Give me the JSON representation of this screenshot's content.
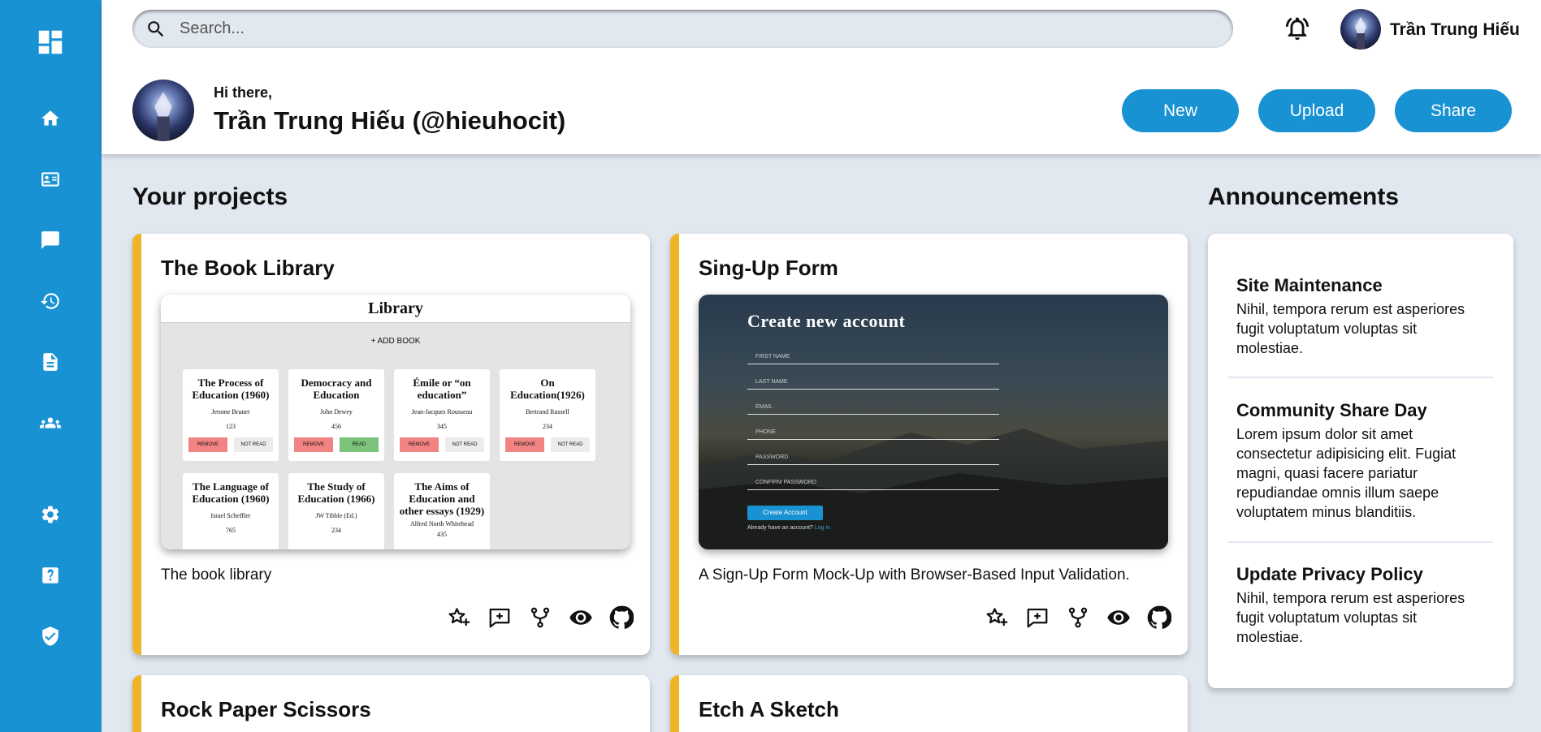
{
  "header": {
    "search_placeholder": "Search...",
    "username": "Trần Trung Hiếu",
    "greeting": "Hi there,",
    "full_name": "Trần Trung Hiếu (@hieuhocit)",
    "buttons": {
      "new": "New",
      "upload": "Upload",
      "share": "Share"
    }
  },
  "sidebar": {
    "items": [
      "home-icon",
      "contact-card-icon",
      "chat-icon",
      "history-icon",
      "document-icon",
      "group-icon",
      "settings-icon",
      "help-icon",
      "shield-icon"
    ]
  },
  "projects": {
    "title": "Your projects",
    "cards": [
      {
        "title": "The Book Library",
        "description": "The book library",
        "preview": {
          "heading": "Library",
          "add_label": "+ ADD BOOK",
          "books": [
            {
              "title": "The Process of Education (1960)",
              "author": "Jerome Bruner",
              "pages": "123",
              "btn1": "REMOVE",
              "btn2": "NOT READ"
            },
            {
              "title": "Democracy and Education",
              "author": "John Dewey",
              "pages": "456",
              "btn1": "REMOVE",
              "btn2": "READ"
            },
            {
              "title": "Émile or “on education”",
              "author": "Jean-Jacques Rousseau",
              "pages": "345",
              "btn1": "REMOVE",
              "btn2": "NOT READ"
            },
            {
              "title": "On Education(1926)",
              "author": "Bertrand Russell",
              "pages": "234",
              "btn1": "REMOVE",
              "btn2": "NOT READ"
            },
            {
              "title": "The Language of Education (1960)",
              "author": "Israel Scheffler",
              "pages": "765"
            },
            {
              "title": "The Study of Education (1966)",
              "author": "JW Tibble (Ed.)",
              "pages": "234"
            },
            {
              "title": "The Aims of Education and other essays (1929)",
              "author": "Alfred North Whitehead",
              "pages": "435"
            }
          ]
        }
      },
      {
        "title": "Sing-Up Form",
        "description": "A Sign-Up Form Mock-Up with Browser-Based Input Validation.",
        "preview": {
          "heading": "Create new account",
          "fields": [
            "FIRST NAME",
            "LAST NAME",
            "EMAIL",
            "PHONE",
            "PASSWORD",
            "CONFIRM PASSWORD"
          ],
          "button": "Create Account",
          "login_text": "Already have an account?",
          "login_link": "Log in"
        }
      },
      {
        "title": "Rock Paper Scissors"
      },
      {
        "title": "Etch A Sketch"
      }
    ]
  },
  "announcements": {
    "title": "Announcements",
    "items": [
      {
        "title": "Site Maintenance",
        "body": "Nihil, tempora rerum est asperiores fugit voluptatum voluptas sit molestiae."
      },
      {
        "title": "Community Share Day",
        "body": "Lorem ipsum dolor sit amet consectetur adipisicing elit. Fugiat magni, quasi facere pariatur repudiandae omnis illum saepe voluptatem minus blanditiis."
      },
      {
        "title": "Update Privacy Policy",
        "body": "Nihil, tempora rerum est asperiores fugit voluptatum voluptas sit molestiae."
      }
    ]
  },
  "colors": {
    "primary": "#1992d4",
    "accent": "#f0b429",
    "background": "#e2e8f0"
  }
}
